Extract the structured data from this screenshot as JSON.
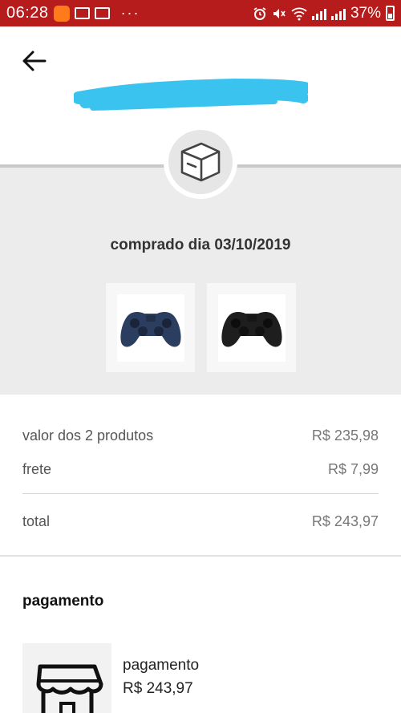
{
  "status_bar": {
    "time": "06:28",
    "dots": "···",
    "battery": "37%"
  },
  "header": {
    "back_icon": "arrow-left-icon",
    "order_id_redacted": true
  },
  "order": {
    "status_icon": "package-box-icon",
    "date_label": "comprado dia 03/10/2019",
    "products": [
      {
        "name": "controle azul",
        "color": "#2c3e5f"
      },
      {
        "name": "controle preto",
        "color": "#1e1e1e"
      }
    ]
  },
  "summary": {
    "products_label": "valor dos 2 produtos",
    "products_value": "R$ 235,98",
    "freight_label": "frete",
    "freight_value": "R$ 7,99",
    "total_label": "total",
    "total_value": "R$ 243,97"
  },
  "payment": {
    "title": "pagamento",
    "icon": "storefront-icon",
    "method_label": "pagamento",
    "method_value": "R$ 243,97"
  },
  "colors": {
    "status_bar": "#b71c1c",
    "redaction": "#3bc3ef",
    "grey_bg": "#ececec"
  }
}
